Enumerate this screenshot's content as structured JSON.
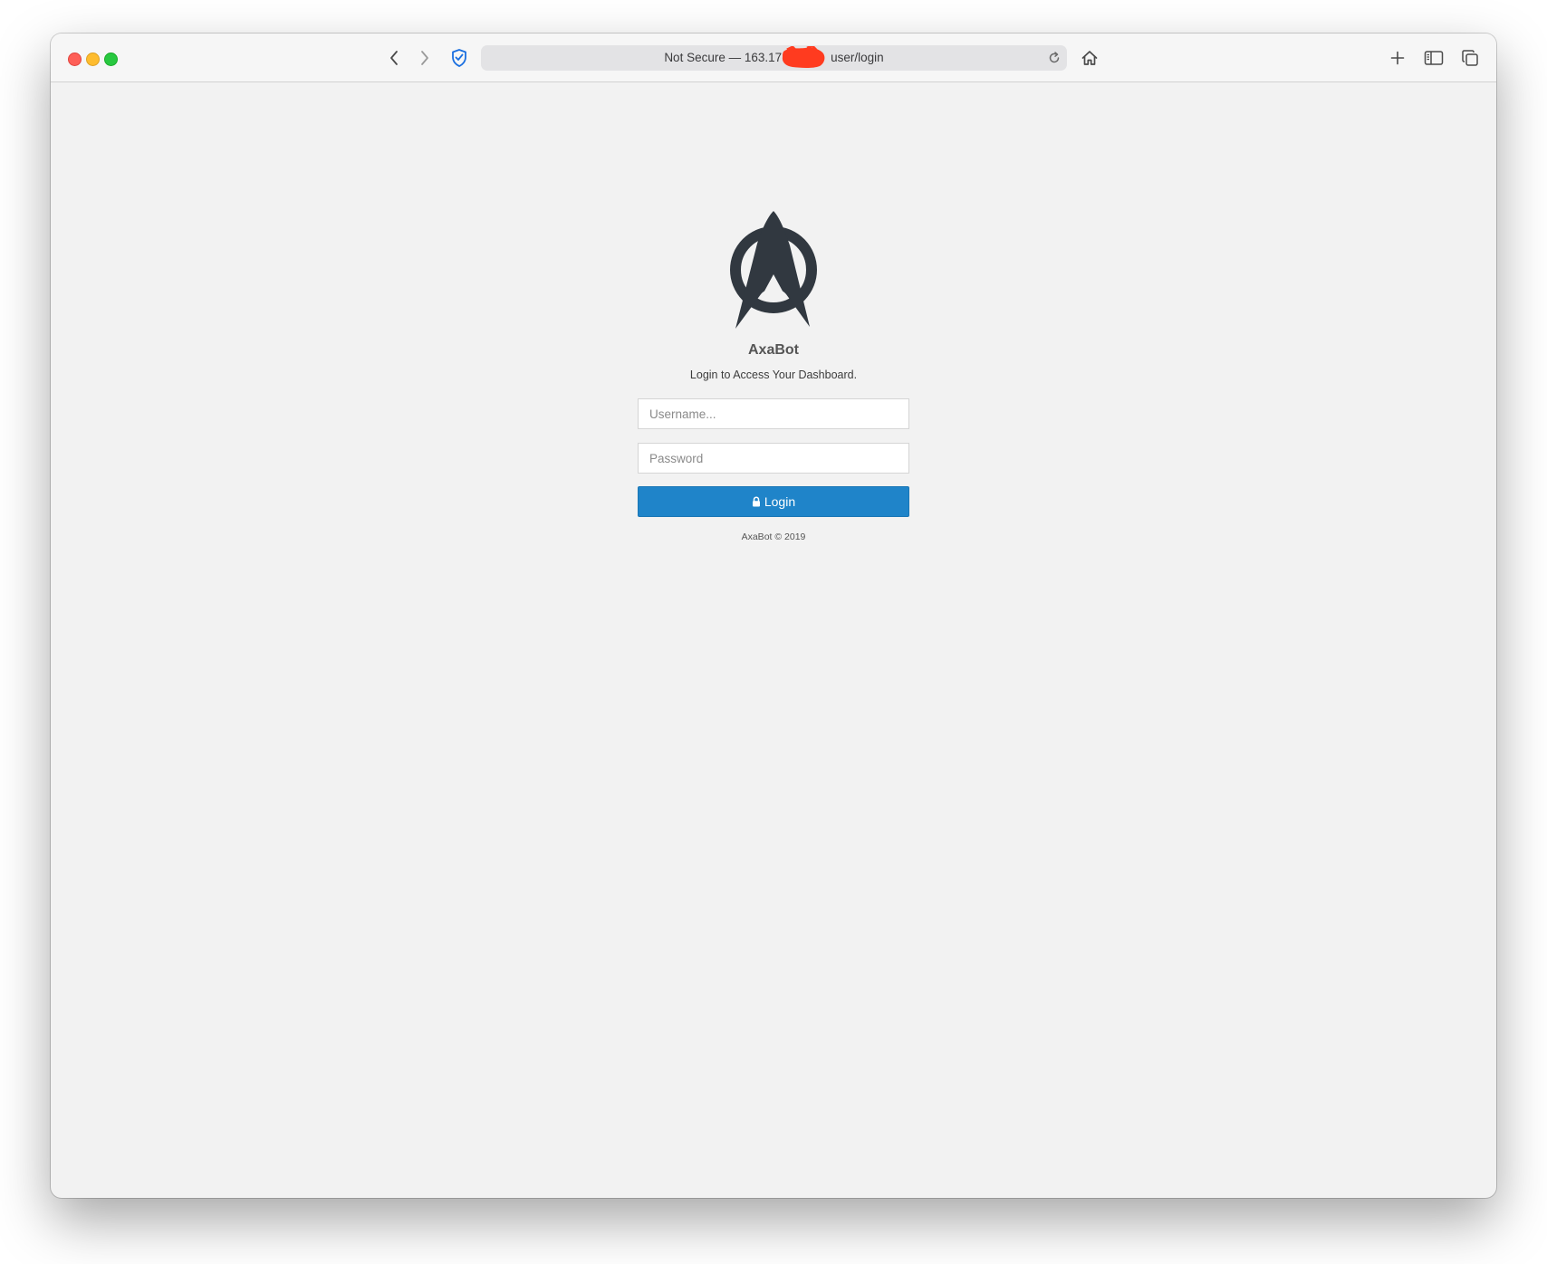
{
  "browser": {
    "address_bar": "Not Secure — 163.17    user/login",
    "icons": [
      "chevron-left-icon",
      "chevron-right-icon",
      "shield-icon",
      "reload-icon",
      "home-icon",
      "plus-icon",
      "sidebar-icon",
      "tabs-overview-icon"
    ]
  },
  "login": {
    "brand": "AxaBot",
    "subtitle": "Login to Access Your Dashboard.",
    "username_placeholder": "Username...",
    "password_placeholder": "Password",
    "button_label": "Login",
    "footer": "AxaBot © 2019"
  },
  "colors": {
    "accent": "#1f84c9",
    "logo": "#313840",
    "background": "#f2f2f2",
    "shield": "#1a6fe0"
  }
}
